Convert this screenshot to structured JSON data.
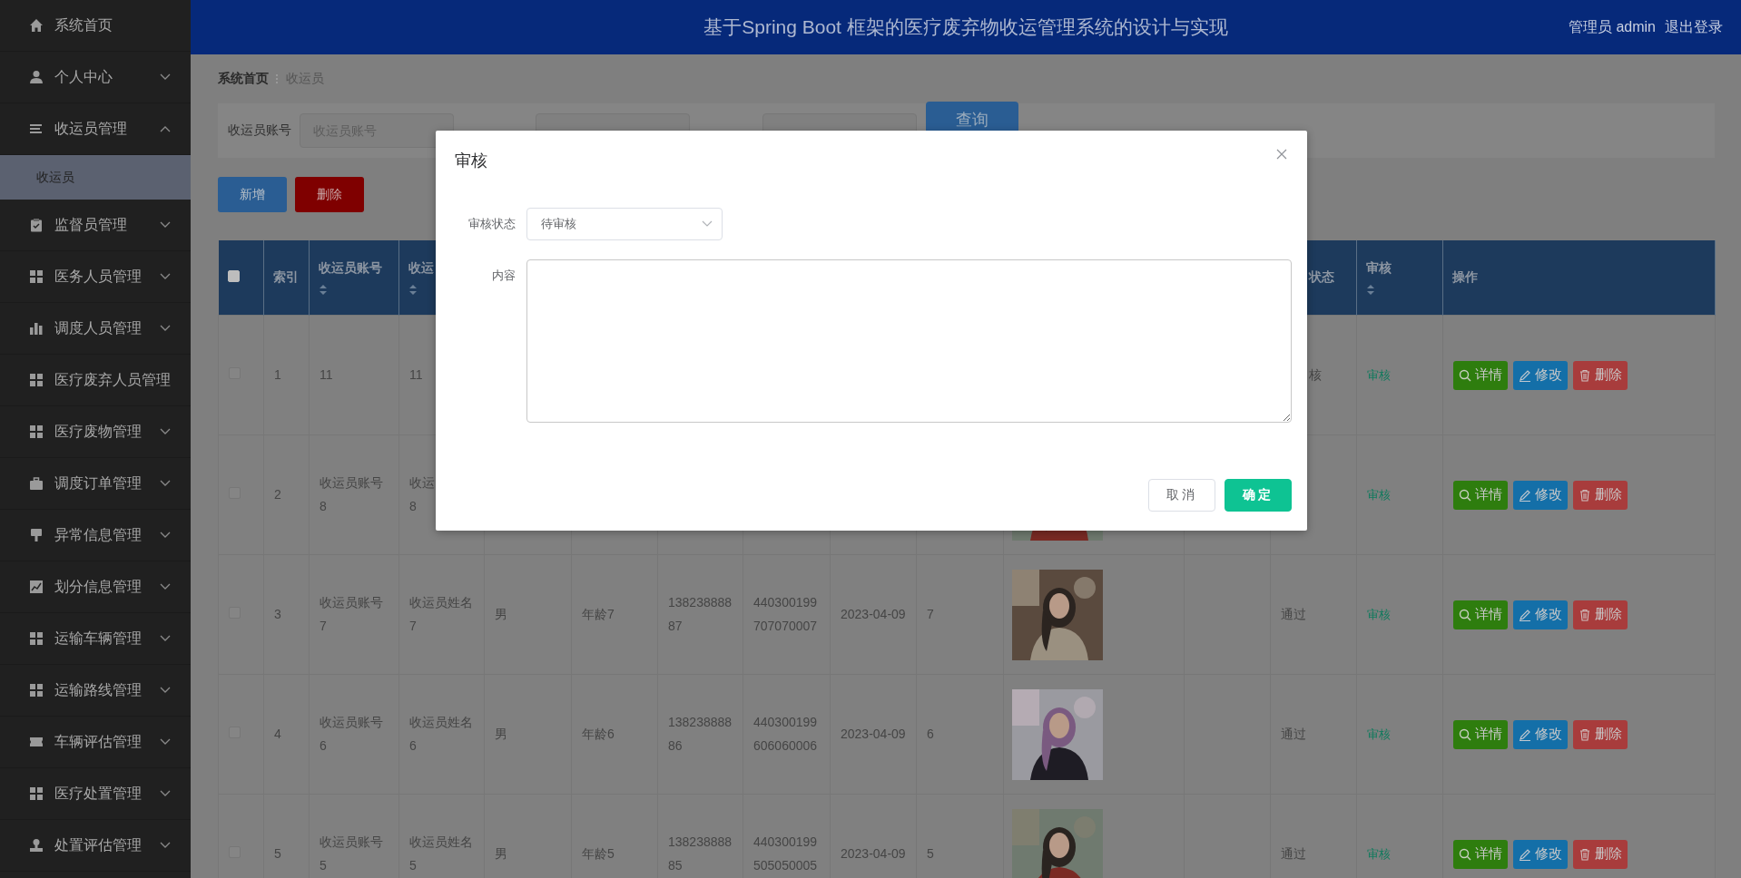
{
  "sidebar": {
    "items": [
      {
        "label": "系统首页",
        "kind": "link"
      },
      {
        "label": "个人中心",
        "kind": "menu",
        "expanded": false
      },
      {
        "label": "收运员管理",
        "kind": "menu",
        "expanded": true,
        "children": [
          {
            "label": "收运员",
            "selected": true
          }
        ]
      },
      {
        "label": "监督员管理",
        "kind": "menu",
        "expanded": false
      },
      {
        "label": "医务人员管理",
        "kind": "menu",
        "expanded": false
      },
      {
        "label": "调度人员管理",
        "kind": "menu",
        "expanded": false
      },
      {
        "label": "医疗废弃人员管理",
        "kind": "link"
      },
      {
        "label": "医疗废物管理",
        "kind": "menu",
        "expanded": false
      },
      {
        "label": "调度订单管理",
        "kind": "menu",
        "expanded": false
      },
      {
        "label": "异常信息管理",
        "kind": "menu",
        "expanded": false
      },
      {
        "label": "划分信息管理",
        "kind": "menu",
        "expanded": false
      },
      {
        "label": "运输车辆管理",
        "kind": "menu",
        "expanded": false
      },
      {
        "label": "运输路线管理",
        "kind": "menu",
        "expanded": false
      },
      {
        "label": "车辆评估管理",
        "kind": "menu",
        "expanded": false
      },
      {
        "label": "医疗处置管理",
        "kind": "menu",
        "expanded": false
      },
      {
        "label": "处置评估管理",
        "kind": "menu",
        "expanded": false
      }
    ]
  },
  "header": {
    "title": "基于Spring Boot 框架的医疗废弃物收运管理系统的设计与实现",
    "user": "管理员 admin",
    "logout": "退出登录"
  },
  "breadcrumb": [
    "系统首页",
    "收运员"
  ],
  "search": {
    "fields": [
      {
        "label": "收运员账号",
        "placeholder": "收运员账号",
        "kind": "input"
      },
      {
        "kind": "covered"
      },
      {
        "kind": "covered"
      }
    ],
    "button": "查询"
  },
  "actions": [
    {
      "label": "新增",
      "kind": "add"
    },
    {
      "label": "删除",
      "kind": "delete"
    }
  ],
  "table": {
    "header_checked": false,
    "columns": [
      {
        "label": "索引"
      },
      {
        "label": "收运员账号",
        "sortable": true
      },
      {
        "label": "收运",
        "sortable": true
      },
      null,
      null,
      null,
      null,
      null,
      null,
      null,
      null,
      {
        "label": "状态",
        "cut": true
      },
      {
        "label": "审核",
        "sortable": true
      },
      {
        "label": "操作"
      }
    ],
    "rows": [
      {
        "checked": false,
        "cells": [
          "1",
          "11",
          "11",
          {
            "kind": "covered"
          },
          {
            "kind": "covered"
          },
          {
            "kind": "covered"
          },
          {
            "kind": "covered"
          },
          {
            "kind": "covered"
          },
          {
            "kind": "covered"
          },
          {
            "kind": "covered"
          },
          {
            "kind": "covered"
          },
          {
            "text": "核",
            "cut": true
          },
          {
            "kind": "link",
            "text": "审核"
          }
        ],
        "actions": [
          {
            "label": "详情",
            "kind": "view"
          },
          {
            "label": "修改",
            "kind": "edit"
          },
          {
            "label": "删除",
            "kind": "delete"
          }
        ]
      },
      {
        "checked": false,
        "cells": [
          "2",
          "收运员账号8",
          "收运\n8",
          {
            "kind": "covered"
          },
          {
            "kind": "covered"
          },
          {
            "kind": "covered"
          },
          {
            "kind": "covered"
          },
          {
            "kind": "covered"
          },
          {
            "kind": "covered"
          },
          {
            "kind": "picture"
          },
          {
            "kind": "covered"
          },
          {
            "kind": "covered"
          },
          {
            "kind": "link",
            "text": "审核"
          }
        ],
        "actions": [
          {
            "label": "详情",
            "kind": "view"
          },
          {
            "label": "修改",
            "kind": "edit"
          },
          {
            "label": "删除",
            "kind": "delete"
          }
        ]
      },
      {
        "checked": false,
        "cells": [
          "3",
          "收运员账号7",
          "收运员姓名7",
          "男",
          "年龄7",
          "13823888887",
          "440300199707070007",
          "2023-04-09",
          "7",
          {
            "kind": "picture"
          },
          {
            "kind": "empty"
          },
          "通过",
          {
            "kind": "link",
            "text": "审核"
          }
        ],
        "actions": [
          {
            "label": "详情",
            "kind": "view"
          },
          {
            "label": "修改",
            "kind": "edit"
          },
          {
            "label": "删除",
            "kind": "delete"
          }
        ]
      },
      {
        "checked": false,
        "cells": [
          "4",
          "收运员账号6",
          "收运员姓名6",
          "男",
          "年龄6",
          "13823888886",
          "440300199606060006",
          "2023-04-09",
          "6",
          {
            "kind": "picture"
          },
          {
            "kind": "empty"
          },
          "通过",
          {
            "kind": "link",
            "text": "审核"
          }
        ],
        "actions": [
          {
            "label": "详情",
            "kind": "view"
          },
          {
            "label": "修改",
            "kind": "edit"
          },
          {
            "label": "删除",
            "kind": "delete"
          }
        ]
      },
      {
        "checked": false,
        "cells": [
          "5",
          "收运员账号5",
          "收运员姓名5",
          "男",
          "年龄5",
          "13823888885",
          "440300199505050005",
          "2023-04-09",
          "5",
          {
            "kind": "picture"
          },
          {
            "kind": "empty"
          },
          "通过",
          {
            "kind": "link",
            "text": "审核"
          }
        ],
        "actions": [
          {
            "label": "详情",
            "kind": "view"
          },
          {
            "label": "修改",
            "kind": "edit"
          },
          {
            "label": "删除",
            "kind": "delete"
          }
        ]
      }
    ]
  },
  "dialog": {
    "title": "审核",
    "fields": [
      {
        "label": "审核状态",
        "kind": "select",
        "value": "待审核"
      },
      {
        "label": "内容",
        "kind": "textarea"
      }
    ],
    "buttons": [
      {
        "label": "取消",
        "kind": "cancel"
      },
      {
        "label": "确定",
        "kind": "primary"
      }
    ]
  }
}
